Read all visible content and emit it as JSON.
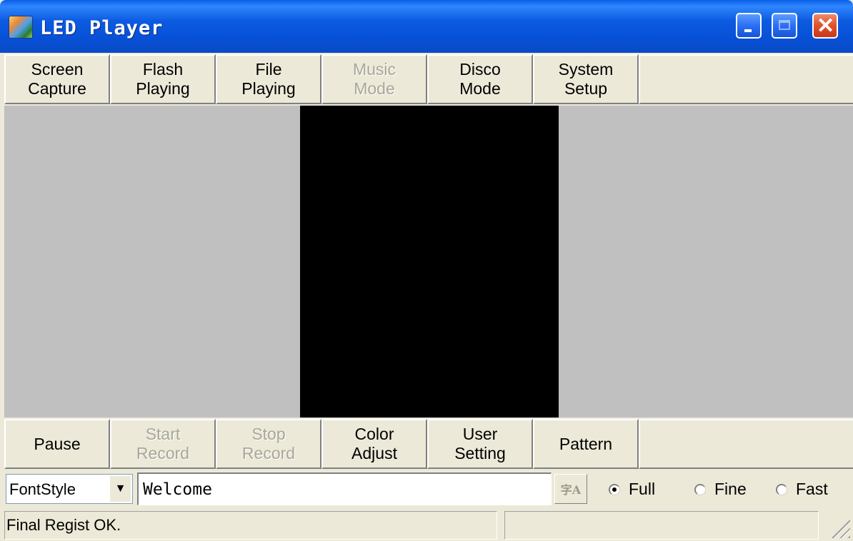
{
  "window": {
    "title": "LED Player",
    "icon": "led-player-app-icon",
    "controls": [
      "minimize-icon",
      "maximize-icon",
      "close-icon"
    ],
    "close_glyph": "✕"
  },
  "toolbar_top": [
    {
      "label": "Screen\nCapture",
      "enabled": true
    },
    {
      "label": "Flash\nPlaying",
      "enabled": true
    },
    {
      "label": "File\nPlaying",
      "enabled": true
    },
    {
      "label": "Music\nMode",
      "enabled": false
    },
    {
      "label": "Disco\nMode",
      "enabled": true
    },
    {
      "label": "System\nSetup",
      "enabled": true
    }
  ],
  "toolbar_bottom": [
    {
      "label": "Pause",
      "enabled": true
    },
    {
      "label": "Start\nRecord",
      "enabled": false
    },
    {
      "label": "Stop\nRecord",
      "enabled": false
    },
    {
      "label": "Color\nAdjust",
      "enabled": true
    },
    {
      "label": "User\nSetting",
      "enabled": true
    },
    {
      "label": "Pattern",
      "enabled": true
    }
  ],
  "text_row": {
    "font_style": "FontStyle",
    "dropdown_glyph": "▼",
    "text_value": "Welcome",
    "font_icon_glyph": "字A",
    "speed_options": [
      {
        "label": "Full",
        "checked": true
      },
      {
        "label": "Fine",
        "checked": false
      },
      {
        "label": "Fast",
        "checked": false
      }
    ]
  },
  "status": {
    "message": "Final Regist OK.",
    "secondary": ""
  },
  "colors": {
    "title_bar": "#0a5fe6",
    "face": "#ece9d8",
    "display_bg": "#c0c0c0",
    "led_screen": "#000000",
    "disabled_text": "#a8a698"
  }
}
